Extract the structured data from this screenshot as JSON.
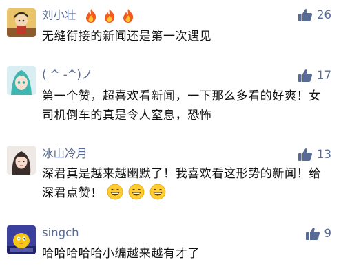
{
  "comments": [
    {
      "username": "刘小壮",
      "username_emoji": [
        "fire",
        "fire",
        "fire"
      ],
      "like_count": "26",
      "text": "无缝衔接的新闻还是第一次遇见"
    },
    {
      "username": "( ^ -^)ノ",
      "like_count": "17",
      "text": "第一个赞，超喜欢看新闻，一下那么多看的好爽！女司机倒车的真是令人窒息，恐怖"
    },
    {
      "username": "冰山冷月",
      "like_count": "13",
      "text": "深君真是越来越幽默了！我喜欢看这形势的新闻！给深君点赞！",
      "text_emoji": [
        "grin",
        "grin",
        "grin"
      ]
    },
    {
      "username": "singch",
      "like_count": "9",
      "text": "哈哈哈哈哈小编越来越有才了"
    }
  ],
  "colors": {
    "username": "#576b95",
    "text": "#111111",
    "like_icon": "#576b95"
  },
  "icons": {
    "like": "thumbs-up-icon",
    "fire": "fire-emoji",
    "grin": "grinning-face-emoji"
  }
}
